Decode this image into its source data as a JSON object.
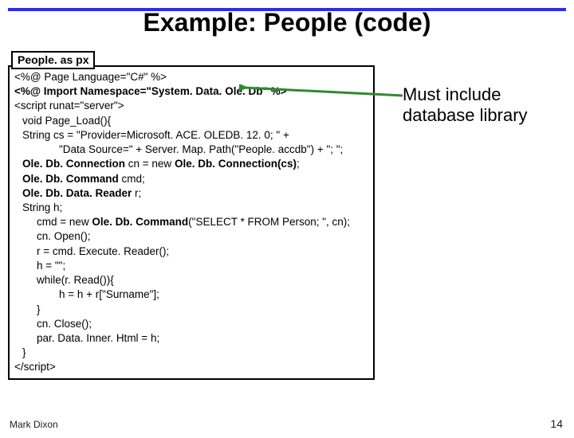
{
  "title": "Example: People (code)",
  "file_label": "People. as\npx",
  "code": {
    "l1": "<%@ Page Language=\"C#\" %>",
    "l2a": "<%@ Import Namespace=\"System. Data. ",
    "l2b": "Ole. Db",
    "l2c": "\" %>",
    "l3": "<script runat=\"server\">",
    "l4": "void Page_Load(){",
    "l5": "String cs = \"Provider=Microsoft. ACE. OLEDB. 12. 0; \" +",
    "l6": "\"Data Source=\" + Server. Map. Path(\"People. accdb\") + \"; \";",
    "l7a": "Ole. Db. Connection",
    "l7b": " cn = new ",
    "l7c": "Ole. Db. Connection(cs)",
    "l7d": ";",
    "l8a": "Ole. Db. Command",
    "l8b": " cmd;",
    "l9a": "Ole. Db. Data. Reader",
    "l9b": " r;",
    "l10": "String h;",
    "l11a": "cmd = new ",
    "l11b": "Ole. Db. Command",
    "l11c": "(\"SELECT * FROM Person; \", cn);",
    "l12": "cn. Open();",
    "l13": "r = cmd. Execute. Reader();",
    "l14": "h = \"\";",
    "l15": "while(r. Read()){",
    "l16": "h = h + r[\"Surname\"];",
    "l17": "}",
    "l18": "cn. Close();",
    "l19": "par. Data. Inner. Html = h;",
    "l20": "}",
    "l21": "</script>"
  },
  "callout": {
    "line1": "Must include",
    "line2": "database library"
  },
  "footer": {
    "author": "Mark Dixon",
    "page": "14"
  }
}
